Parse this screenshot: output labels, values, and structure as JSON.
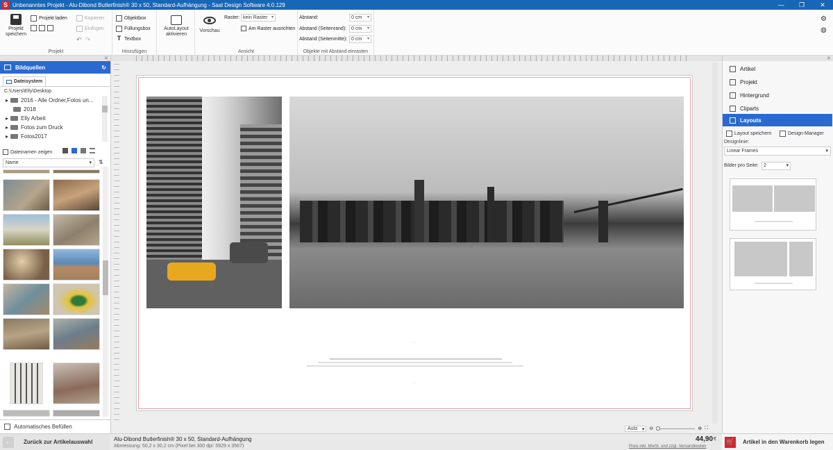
{
  "titlebar": {
    "title": "Unbenanntes Projekt - Alu-Dibond Butlerfinish® 30 x 50, Standard-Aufhängung - Saal Design Software 4.0.129"
  },
  "ribbon": {
    "projekt": {
      "save": "Projekt",
      "save2": "speichern",
      "load": "Projekt laden",
      "copy": "Kopieren",
      "paste": "Einfügen",
      "label": "Projekt"
    },
    "hinzufuegen": {
      "objektbox": "Objektbox",
      "fuellungsbox": "Füllungsbox",
      "textbox": "Textbox",
      "label": "Hinzufügen"
    },
    "autolayout": {
      "line1": "AutoLayout",
      "line2": "aktivieren"
    },
    "ansicht": {
      "vorschau": "Vorschau",
      "raster_label": "Raster:",
      "raster_value": "kein Raster",
      "am_raster": "Am Raster ausrichten",
      "label": "Ansicht"
    },
    "abstand": {
      "abstand": "Abstand:",
      "rand": "Abstand (Seitenrand):",
      "mitte": "Abstand (Seitenmitte):",
      "v1": "0 cm",
      "v2": "0 cm",
      "v3": "0 cm",
      "label": "Objekte mit Abstand einrasten"
    }
  },
  "left": {
    "title": "Bildquellen",
    "tab": "Dateisystem",
    "path": "C:\\Users\\Elly\\Desktop",
    "folders": [
      "2016 - Alle Ordner,Fotos un...",
      "2018",
      "Elly Arbeit",
      "Fotos zum Druck",
      "Fotos2017"
    ],
    "show_filenames": "Dateinamen zeigen",
    "sort": "Name",
    "autofill": "Automatisches Befüllen"
  },
  "right": {
    "nav": [
      "Artikel",
      "Projekt",
      "Hintergrund",
      "Cliparts",
      "Layouts"
    ],
    "save_layout": "Layout speichern",
    "design_manager": "Design-Manager",
    "designlinie_label": "Designlinie:",
    "designlinie_value": "Linear Frames",
    "bilder_label": "Bilder pro Seite:",
    "bilder_value": "2"
  },
  "zoom": {
    "value": "Auto"
  },
  "bottom": {
    "back": "Zurück zur Artikelauswahl",
    "product": "Alu-Dibond Butlerfinish® 30 x 50, Standard-Aufhängung",
    "dimensions": "Abmessung: 50,2 x 30,2 cm (Pixel bei 300 dpi: 5929 x 3567)",
    "price": "44,90",
    "currency": "€",
    "price_note": "Preis inkl. MwSt. und zzgl. Versandkosten",
    "cart": "Artikel in den Warenkorb legen"
  },
  "colors": {
    "accent": "#2a6ad0",
    "titlebar": "#1766b8",
    "brand": "#d6262d"
  }
}
